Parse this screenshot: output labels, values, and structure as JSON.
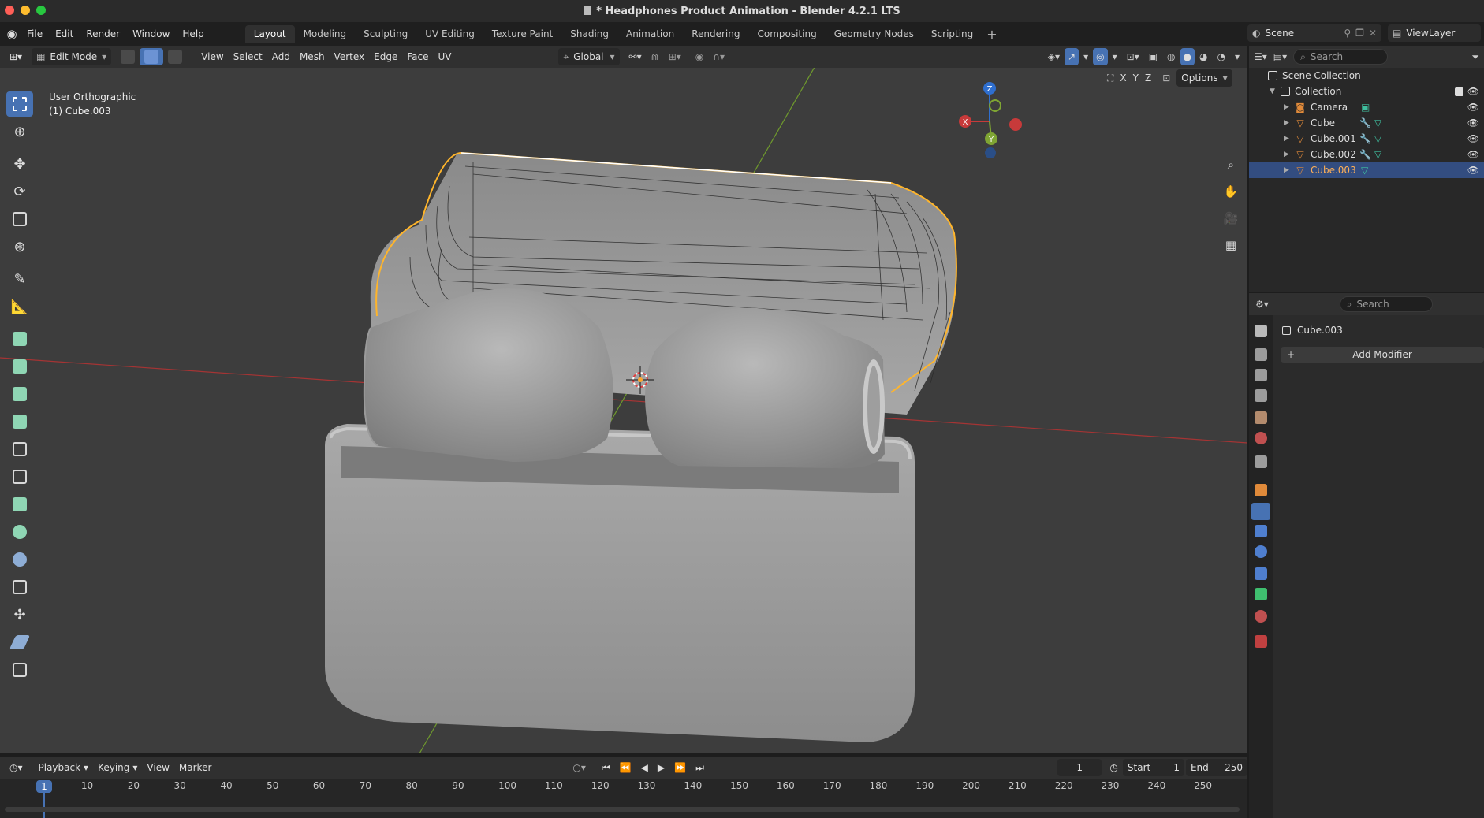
{
  "window": {
    "title": "* Headphones Product Animation - Blender 4.2.1 LTS",
    "controls": [
      "#ff5f57",
      "#febc2e",
      "#28c840"
    ]
  },
  "menu": {
    "items": [
      "File",
      "Edit",
      "Render",
      "Window",
      "Help"
    ]
  },
  "workspaces": {
    "tabs": [
      "Layout",
      "Modeling",
      "Sculpting",
      "UV Editing",
      "Texture Paint",
      "Shading",
      "Animation",
      "Rendering",
      "Compositing",
      "Geometry Nodes",
      "Scripting"
    ],
    "active": "Layout"
  },
  "scene": {
    "name": "Scene",
    "view_layer": "ViewLayer"
  },
  "viewport_header": {
    "mode": "Edit Mode",
    "menus": [
      "View",
      "Select",
      "Add",
      "Mesh",
      "Vertex",
      "Edge",
      "Face",
      "UV"
    ],
    "transform_orientation": "Global",
    "options_label": "Options",
    "axis_labels": [
      "X",
      "Y",
      "Z"
    ]
  },
  "viewport": {
    "view_name": "User Orthographic",
    "object_info": "(1) Cube.003",
    "gizmo_axes": [
      "X",
      "Y",
      "Z"
    ]
  },
  "outliner": {
    "search_placeholder": "Search",
    "root": "Scene Collection",
    "collection": "Collection",
    "items": [
      {
        "name": "Camera",
        "type": "camera"
      },
      {
        "name": "Cube",
        "type": "mesh"
      },
      {
        "name": "Cube.001",
        "type": "mesh"
      },
      {
        "name": "Cube.002",
        "type": "mesh"
      },
      {
        "name": "Cube.003",
        "type": "mesh",
        "selected": true
      }
    ]
  },
  "properties": {
    "search_placeholder": "Search",
    "object_name": "Cube.003",
    "add_modifier_label": "Add Modifier"
  },
  "timeline": {
    "menus": [
      "Playback",
      "Keying",
      "View",
      "Marker"
    ],
    "current_frame": "1",
    "start_label": "Start",
    "start_value": "1",
    "end_label": "End",
    "end_value": "250",
    "ticks": [
      "1",
      "10",
      "20",
      "30",
      "40",
      "50",
      "60",
      "70",
      "80",
      "90",
      "100",
      "110",
      "120",
      "130",
      "140",
      "150",
      "160",
      "170",
      "180",
      "190",
      "200",
      "210",
      "220",
      "230",
      "240",
      "250"
    ]
  },
  "colors": {
    "accent": "#4772b3",
    "selection_outline": "#ffb52b",
    "axis_x": "#c73a3a",
    "axis_y": "#7fa533",
    "axis_z": "#2f6fcf"
  }
}
